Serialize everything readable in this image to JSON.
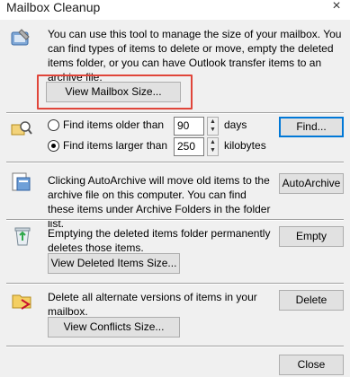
{
  "window": {
    "title": "Mailbox Cleanup",
    "close_glyph": "×"
  },
  "section_mailbox": {
    "text": "You can use this tool to manage the size of your mailbox. You can find types of items to delete or move, empty the deleted items folder, or you can have Outlook transfer items to an archive file.",
    "view_size_button": "View Mailbox Size..."
  },
  "section_find": {
    "older_label": "Find items older than",
    "older_value": "90",
    "older_unit": "days",
    "larger_label": "Find items larger than",
    "larger_value": "250",
    "larger_unit": "kilobytes",
    "selected": "larger",
    "find_button": "Find..."
  },
  "section_archive": {
    "text": "Clicking AutoArchive will move old items to the archive file on this computer. You can find these items under Archive Folders in the folder list.",
    "button": "AutoArchive"
  },
  "section_deleted": {
    "text": "Emptying the deleted items folder permanently deletes those items.",
    "empty_button": "Empty",
    "view_button": "View Deleted Items Size..."
  },
  "section_conflicts": {
    "text": "Delete all alternate versions of items in your mailbox.",
    "delete_button": "Delete",
    "view_button": "View Conflicts Size..."
  },
  "footer": {
    "close_button": "Close"
  },
  "colors": {
    "highlight": "#e0453a",
    "panel": "#f0f0f0",
    "button": "#e1e1e1",
    "focus": "#0078d7"
  }
}
